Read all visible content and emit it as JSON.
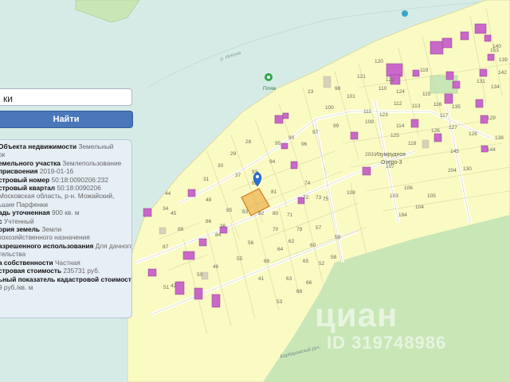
{
  "search": {
    "value": "ки"
  },
  "find_button": {
    "label": "Найти"
  },
  "info_panel": {
    "rows": [
      [
        {
          "k": "Объекта недвижимости ",
          "v": "Земельный"
        }
      ],
      [
        {
          "k": "",
          "v": "ок"
        }
      ],
      [
        {
          "k": "емельного участка ",
          "v": "Землепользование"
        }
      ],
      [
        {
          "k": "присвоения ",
          "v": "2019-01-16"
        }
      ],
      [
        {
          "k": "стровый номер ",
          "v": "50:18:0090206:232"
        }
      ],
      [
        {
          "k": "стровый квартал ",
          "v": "50:18:0090206"
        }
      ],
      [
        {
          "k": "",
          "v": " Московская область, р-н. Можайский,"
        }
      ],
      [
        {
          "k": "",
          "v": "ьшие Парфенки"
        }
      ],
      [
        {
          "k": "адь уточненная ",
          "v": "900 кв. м"
        }
      ],
      [
        {
          "k": "с ",
          "v": "Учтенный"
        }
      ],
      [
        {
          "k": "ория земель ",
          "v": "Земли"
        }
      ],
      [
        {
          "k": "",
          "v": "кохозяйственного назначения"
        }
      ],
      [
        {
          "k": "азрешенного использования ",
          "v": "Для дачного"
        }
      ],
      [
        {
          "k": "",
          "v": "тельства"
        }
      ],
      [
        {
          "k": "а собственности ",
          "v": "Частная"
        }
      ],
      [
        {
          "k": "стровая стоимость ",
          "v": "235731 руб."
        }
      ],
      [
        {
          "k": "ьный показатель кадастровой стоимости",
          "v": ""
        }
      ],
      [
        {
          "k": "",
          "v": "9 руб./кв. м"
        }
      ]
    ]
  },
  "map": {
    "beach_label": "Пляж",
    "river_label": "р. Искона",
    "lake_label_1": "Изумрудное",
    "lake_label_2": "Озеро-3",
    "stream_label": "Барбаровский руч.",
    "parcel_numbers": [
      "23",
      "29",
      "30",
      "31",
      "34",
      "37",
      "36",
      "28",
      "90",
      "93",
      "94",
      "95",
      "92",
      "81",
      "83",
      "80",
      "82",
      "71",
      "72",
      "73",
      "70",
      "79",
      "74",
      "75",
      "60",
      "65",
      "64",
      "63",
      "62",
      "57",
      "59",
      "58",
      "66",
      "68",
      "69",
      "52",
      "56",
      "55",
      "41",
      "42",
      "51",
      "53",
      "84",
      "85",
      "86",
      "87",
      "88",
      "98",
      "99",
      "97",
      "96",
      "100",
      "101",
      "105",
      "106",
      "107",
      "108",
      "109",
      "110",
      "111",
      "112",
      "113",
      "114",
      "115",
      "116",
      "117",
      "118",
      "119",
      "120",
      "121",
      "122",
      "123",
      "124",
      "125",
      "126",
      "127",
      "128",
      "129",
      "130",
      "131",
      "134",
      "135",
      "138",
      "139",
      "140",
      "142",
      "144",
      "145",
      "153",
      "184",
      "203",
      "204",
      "103",
      "104",
      "44",
      "45",
      "46",
      "50",
      "48"
    ]
  },
  "watermark": {
    "brand": "циан",
    "id": "ID 319748986"
  },
  "colors": {
    "map_bg": "#d7ebe6",
    "land": "#fafac3",
    "forest": "#c9e6b7",
    "building": "#c968c9",
    "selected_parcel": "#e89a2d",
    "button": "#4a77b9",
    "marker": "#2d6fd4"
  }
}
